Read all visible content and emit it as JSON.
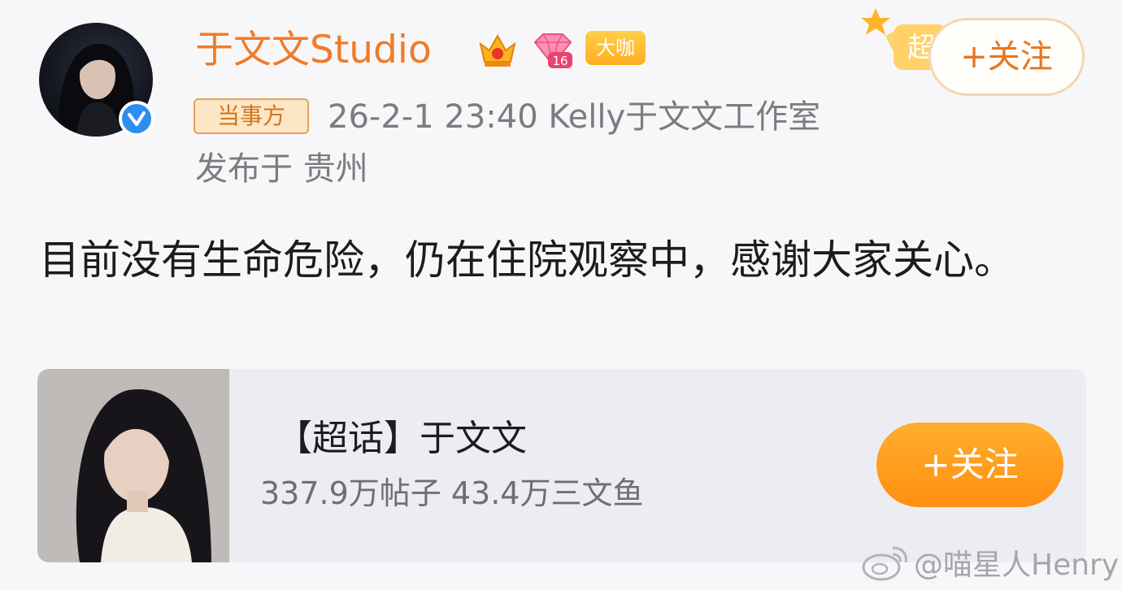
{
  "post": {
    "author_name": "于文文Studio",
    "badges": {
      "daka": "大咖",
      "level": "16"
    },
    "chaohua_badge": "超",
    "follow_button": "+关注",
    "party_tag": "当事方",
    "meta": "26-2-1 23:40  Kelly于文文工作室",
    "location": "发布于 贵州",
    "body": "目前没有生命危险，仍在住院观察中，感谢大家关心。"
  },
  "topic_card": {
    "title": "【超话】于文文",
    "stats": "337.9万帖子 43.4万三文鱼",
    "follow_button": "+关注"
  },
  "watermark": "@喵星人Henry",
  "colors": {
    "author_name": "#f07b2a",
    "follow_card": "#ff9a1f",
    "verify": "#2d8ef0",
    "meta_text": "#7b7b80"
  },
  "icons": [
    "verified-icon",
    "crown-badge-icon",
    "gem-level-badge-icon",
    "weibo-logo-icon"
  ]
}
